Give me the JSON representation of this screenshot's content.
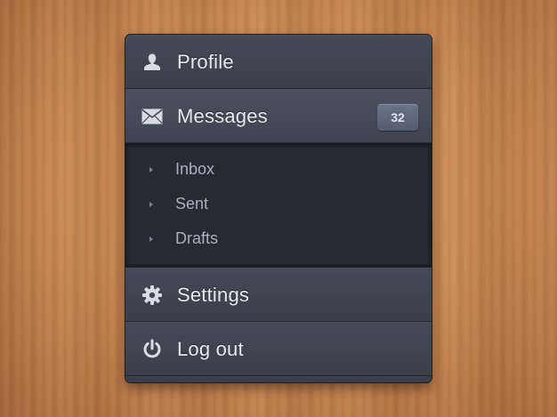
{
  "menu": {
    "profile": {
      "label": "Profile",
      "icon": "user-icon"
    },
    "messages": {
      "label": "Messages",
      "icon": "envelope-icon",
      "badge": "32",
      "submenu": [
        {
          "label": "Inbox"
        },
        {
          "label": "Sent"
        },
        {
          "label": "Drafts"
        }
      ]
    },
    "settings": {
      "label": "Settings",
      "icon": "gear-icon"
    },
    "logout": {
      "label": "Log out",
      "icon": "power-icon"
    }
  },
  "colors": {
    "panel": "#3a3f4b",
    "submenu_bg": "#262a33",
    "badge": "#5d6679",
    "text": "#e7e9ee",
    "subtext": "#a9b1c1",
    "wood": "#c98a55"
  }
}
